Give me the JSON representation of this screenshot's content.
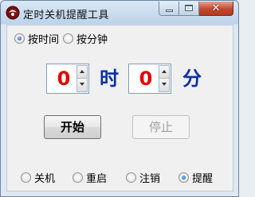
{
  "window": {
    "title": "定时关机提醒工具",
    "close_glyph": "✕"
  },
  "mode": {
    "options": [
      {
        "label": "按时间",
        "checked": true
      },
      {
        "label": "按分钟",
        "checked": false
      }
    ]
  },
  "time": {
    "hours_value": "0",
    "hours_unit": "时",
    "minutes_value": "0",
    "minutes_unit": "分"
  },
  "buttons": {
    "start_label": "开始",
    "stop_label": "停止",
    "stop_enabled": false
  },
  "action": {
    "options": [
      {
        "label": "关机",
        "checked": false
      },
      {
        "label": "重启",
        "checked": false
      },
      {
        "label": "注销",
        "checked": false
      },
      {
        "label": "提醒",
        "checked": true
      }
    ]
  },
  "icons": {
    "app": "app-icon",
    "minimize": "minimize-icon",
    "maximize": "maximize-icon",
    "close": "close-icon",
    "spin_up": "chevron-up-icon",
    "spin_down": "chevron-down-icon"
  },
  "colors": {
    "spin_value": "#e00000",
    "unit_label": "#0a2fa8"
  }
}
